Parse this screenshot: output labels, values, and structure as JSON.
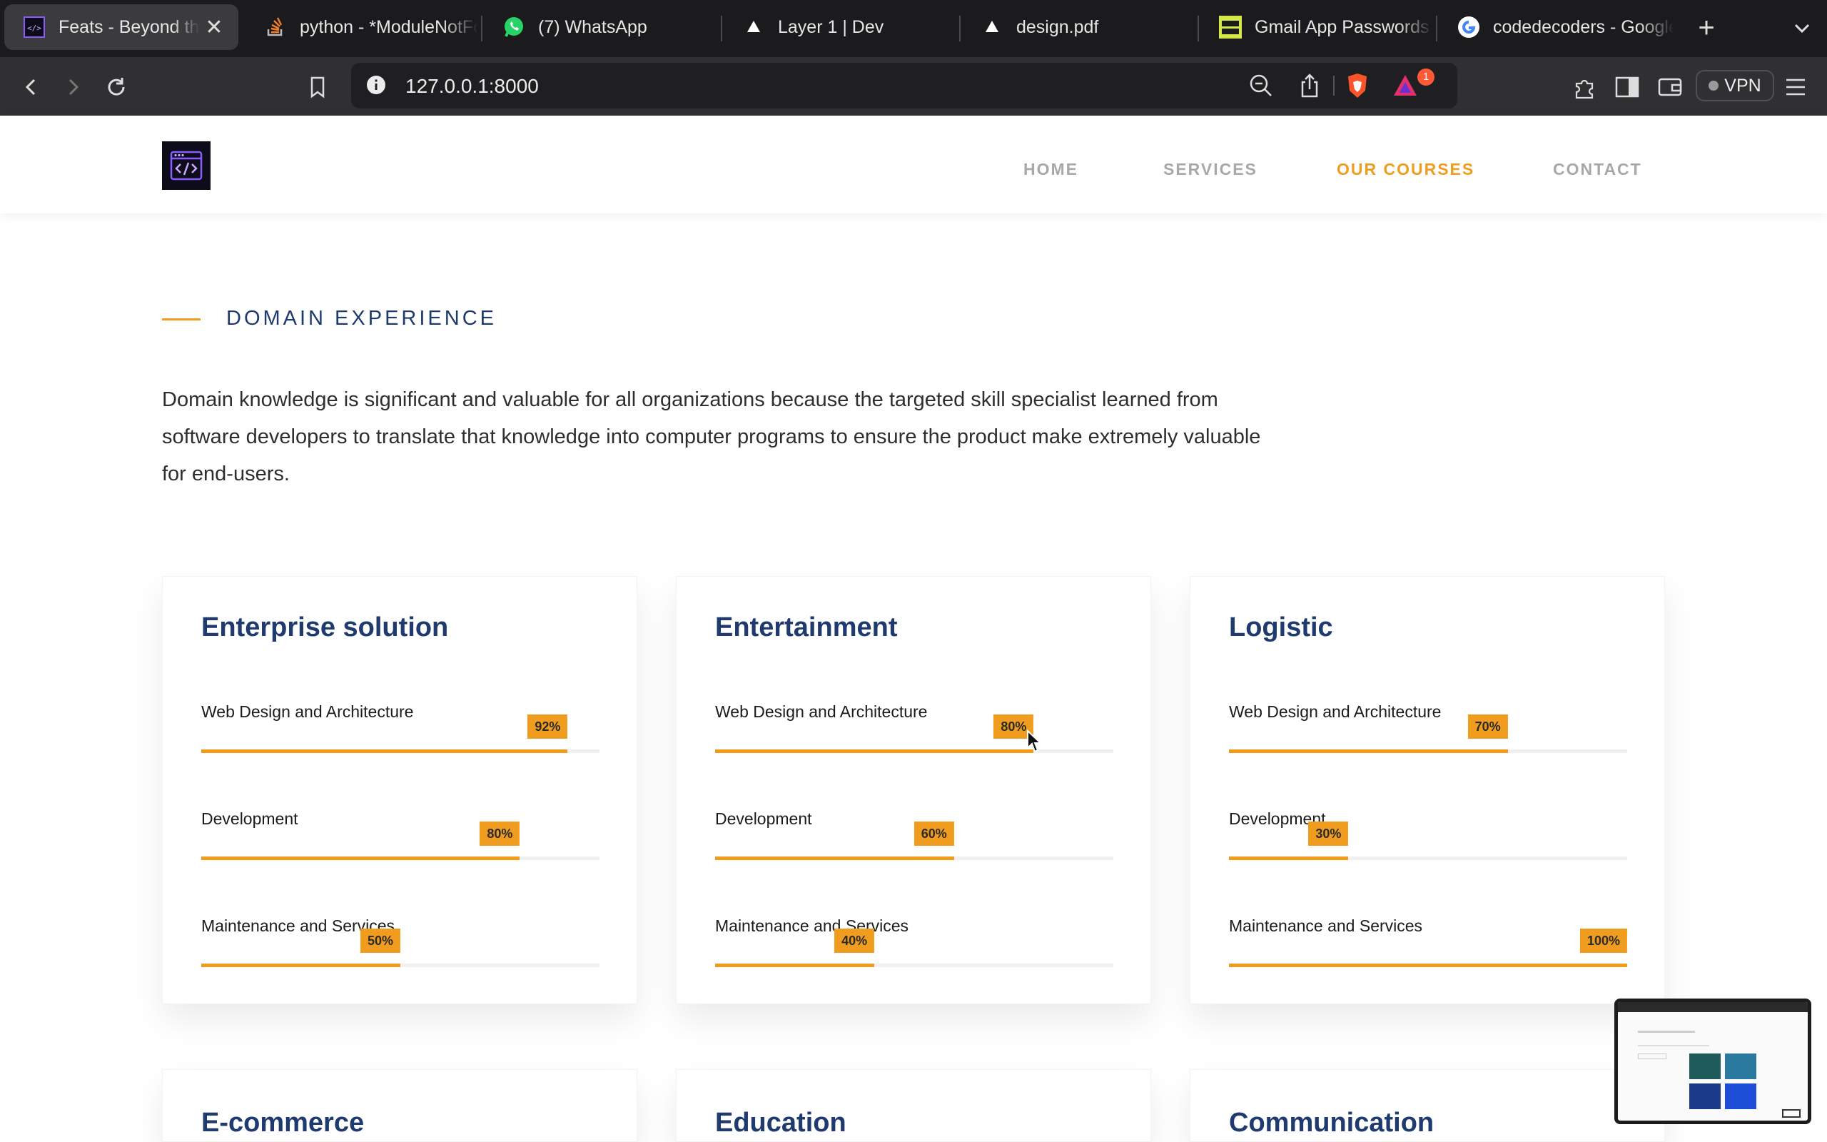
{
  "browser": {
    "tabs": [
      {
        "title": "Feats - Beyond the",
        "icon": "feats-logo-icon",
        "active": true
      },
      {
        "title": "python - *ModuleNotFoundError",
        "icon": "stackoverflow-icon"
      },
      {
        "title": "(7) WhatsApp",
        "icon": "whatsapp-icon"
      },
      {
        "title": "Layer 1 | Dev",
        "icon": "triangle-icon"
      },
      {
        "title": "design.pdf",
        "icon": "triangle-icon"
      },
      {
        "title": "Gmail App Passwords",
        "icon": "zdnet-icon"
      },
      {
        "title": "codedecoders - Google",
        "icon": "google-icon"
      }
    ],
    "close_glyph": "✕",
    "new_tab_glyph": "+",
    "url": "127.0.0.1:8000",
    "notification_count": "1",
    "vpn_label": "VPN"
  },
  "site": {
    "nav": [
      {
        "label": "HOME",
        "active": false
      },
      {
        "label": "SERVICES",
        "active": false
      },
      {
        "label": "OUR COURSES",
        "active": true
      },
      {
        "label": "CONTACT",
        "active": false
      }
    ],
    "accent_color": "#f09d1f",
    "heading_color": "#1e3a6e"
  },
  "section": {
    "eyebrow": "DOMAIN EXPERIENCE",
    "intro": "Domain knowledge is significant and valuable for all organizations because the targeted skill specialist learned from software developers to translate that knowledge into computer programs to ensure the product make extremely valuable for end-users."
  },
  "cards": [
    {
      "title": "Enterprise solution",
      "skills": [
        {
          "label": "Web Design and Architecture",
          "value": "92%"
        },
        {
          "label": "Development",
          "value": "80%"
        },
        {
          "label": "Maintenance and Services",
          "value": "50%"
        }
      ]
    },
    {
      "title": "Entertainment",
      "skills": [
        {
          "label": "Web Design and Architecture",
          "value": "80%"
        },
        {
          "label": "Development",
          "value": "60%"
        },
        {
          "label": "Maintenance and Services",
          "value": "40%"
        }
      ]
    },
    {
      "title": "Logistic",
      "skills": [
        {
          "label": "Web Design and Architecture",
          "value": "70%"
        },
        {
          "label": "Development",
          "value": "30%"
        },
        {
          "label": "Maintenance and Services",
          "value": "100%"
        }
      ]
    },
    {
      "title": "E-commerce",
      "skills": []
    },
    {
      "title": "Education",
      "skills": []
    },
    {
      "title": "Communication",
      "skills": []
    }
  ]
}
